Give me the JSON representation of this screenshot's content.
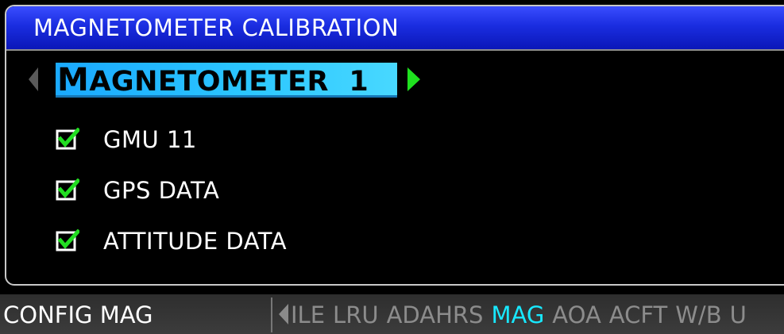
{
  "panel": {
    "title": "MAGNETOMETER CALIBRATION",
    "selector": {
      "first_letter": "M",
      "rest": "AGNETOMETER",
      "number": "1"
    },
    "checks": [
      {
        "label": "GMU 11",
        "checked": true
      },
      {
        "label": "GPS DATA",
        "checked": true
      },
      {
        "label": "ATTITUDE DATA",
        "checked": true
      }
    ]
  },
  "status_bar": {
    "page_name": "CONFIG MAG",
    "tabs": [
      "ILE",
      "LRU",
      "ADAHRS",
      "MAG",
      "AOA",
      "ACFT",
      "W/B",
      "U"
    ],
    "active_tab": "MAG"
  },
  "colors": {
    "title_bar": "#1a2de0",
    "selector_field": "#2bc6ff",
    "arrow_active": "#1fe11f",
    "checkmark": "#22dd22",
    "active_tab": "#18e8ff",
    "inactive_tab": "#8c8c8c"
  },
  "icons": {
    "left_arrow": "triangle-left",
    "right_arrow": "triangle-right",
    "checkbox": "checked-box"
  }
}
